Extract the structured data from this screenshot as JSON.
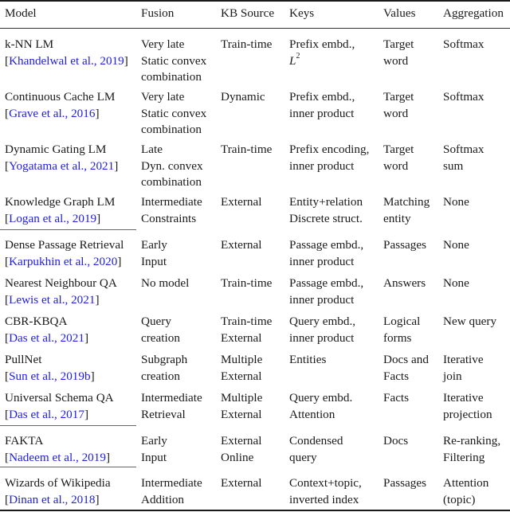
{
  "headers": [
    "Model",
    "Fusion",
    "KB Source",
    "Keys",
    "Values",
    "Aggregation"
  ],
  "rows": [
    {
      "model": "k-NN LM",
      "cite": "Khandelwal et al., 2019",
      "fusion": [
        "Very late",
        "Static convex",
        "combination"
      ],
      "kb": [
        "Train-time"
      ],
      "keys": [
        "Prefix embd.,",
        "L2"
      ],
      "values": [
        "Target",
        "word"
      ],
      "agg": [
        "Softmax"
      ]
    },
    {
      "model": "Continuous Cache LM",
      "cite": "Grave et al., 2016",
      "fusion": [
        "Very late",
        "Static convex",
        "combination"
      ],
      "kb": [
        "Dynamic"
      ],
      "keys": [
        "Prefix embd.,",
        "inner product"
      ],
      "values": [
        "Target",
        "word"
      ],
      "agg": [
        "Softmax"
      ]
    },
    {
      "model": "Dynamic Gating LM",
      "cite": "Yogatama et al., 2021",
      "fusion": [
        "Late",
        "Dyn. convex",
        "combination"
      ],
      "kb": [
        "Train-time"
      ],
      "keys": [
        "Prefix encoding,",
        "inner product"
      ],
      "values": [
        "Target",
        "word"
      ],
      "agg": [
        "Softmax",
        "sum"
      ]
    },
    {
      "model": "Knowledge Graph LM",
      "cite": "Logan et al., 2019",
      "fusion": [
        "Intermediate",
        "Constraints"
      ],
      "kb": [
        "External"
      ],
      "keys": [
        "Entity+relation",
        "Discrete struct."
      ],
      "values": [
        "Matching",
        "entity"
      ],
      "agg": [
        "None"
      ]
    },
    {
      "model": "Dense Passage Retrieval",
      "cite": "Karpukhin et al., 2020",
      "fusion": [
        "Early",
        "Input"
      ],
      "kb": [
        "External"
      ],
      "keys": [
        "Passage embd.,",
        "inner product"
      ],
      "values": [
        "Passages"
      ],
      "agg": [
        "None"
      ]
    },
    {
      "model": "Nearest Neighbour QA",
      "cite": "Lewis et al., 2021",
      "fusion": [
        "No model"
      ],
      "kb": [
        "Train-time"
      ],
      "keys": [
        "Passage embd.,",
        "inner product"
      ],
      "values": [
        "Answers"
      ],
      "agg": [
        "None"
      ]
    },
    {
      "model": "CBR-KBQA",
      "cite": "Das et al., 2021",
      "fusion": [
        "Query",
        "creation"
      ],
      "kb": [
        "Train-time",
        "External"
      ],
      "keys": [
        "Query embd.,",
        "inner product"
      ],
      "values": [
        "Logical",
        "forms"
      ],
      "agg": [
        "New query"
      ]
    },
    {
      "model": "PullNet",
      "cite": "Sun et al., 2019b",
      "fusion": [
        "Subgraph",
        "creation"
      ],
      "kb": [
        "Multiple",
        "External"
      ],
      "keys": [
        "Entities"
      ],
      "values": [
        "Docs and",
        "Facts"
      ],
      "agg": [
        "Iterative",
        "join"
      ]
    },
    {
      "model": "Universal Schema QA",
      "cite": "Das et al., 2017",
      "fusion": [
        "Intermediate",
        "Retrieval"
      ],
      "kb": [
        "Multiple",
        "External"
      ],
      "keys": [
        "Query embd.",
        "Attention"
      ],
      "values": [
        "Facts"
      ],
      "agg": [
        "Iterative",
        "projection"
      ]
    },
    {
      "model": "FAKTA",
      "cite": "Nadeem et al., 2019",
      "fusion": [
        "Early",
        "Input"
      ],
      "kb": [
        "External",
        "Online"
      ],
      "keys": [
        "Condensed",
        "query"
      ],
      "values": [
        "Docs"
      ],
      "agg": [
        "Re-ranking,",
        "Filtering"
      ]
    },
    {
      "model": "Wizards of Wikipedia",
      "cite": "Dinan et al., 2018",
      "fusion": [
        "Intermediate",
        "Addition"
      ],
      "kb": [
        "External"
      ],
      "keys": [
        "Context+topic,",
        "inverted index"
      ],
      "values": [
        "Passages"
      ],
      "agg": [
        "Attention",
        "(topic)"
      ]
    }
  ]
}
